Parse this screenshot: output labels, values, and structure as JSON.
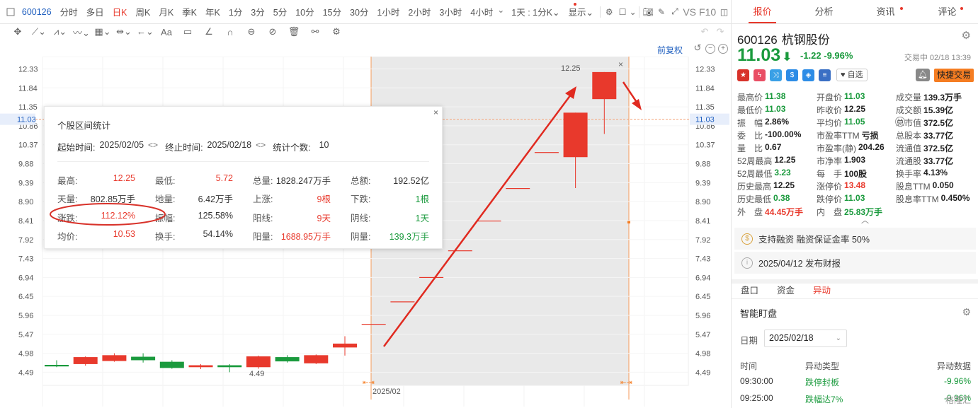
{
  "toolbar": {
    "code": "600126",
    "periods": [
      "分时",
      "多日",
      "日K",
      "周K",
      "月K",
      "季K",
      "年K",
      "1分",
      "3分",
      "5分",
      "10分",
      "15分",
      "30分",
      "1小时",
      "2小时",
      "3小时",
      "4小时"
    ],
    "active_period": "日K",
    "kline_select": "1天 : 1分K",
    "display_label": "显示",
    "vs_label": "VS",
    "f10_label": "F10"
  },
  "chart_header": {
    "restore_label": "前复权"
  },
  "chart_data": {
    "type": "candlestick",
    "y_ticks": [
      "12.33",
      "11.84",
      "11.35",
      "10.86",
      "10.37",
      "9.88",
      "9.39",
      "8.90",
      "8.41",
      "7.92",
      "7.43",
      "6.94",
      "6.45",
      "5.96",
      "5.47",
      "4.98",
      "4.49"
    ],
    "ylim": [
      4.15,
      12.65
    ],
    "current_price_label": "11.03",
    "current_price": 11.03,
    "x_label": "2025/02",
    "max_label": "12.25",
    "min_label": "4.49",
    "candles": [
      {
        "o": 4.68,
        "c": 4.64,
        "h": 4.8,
        "l": 4.62,
        "color": "green"
      },
      {
        "o": 4.7,
        "c": 4.88,
        "h": 4.9,
        "l": 4.66,
        "color": "red"
      },
      {
        "o": 4.78,
        "c": 4.93,
        "h": 4.98,
        "l": 4.76,
        "color": "red"
      },
      {
        "o": 4.89,
        "c": 4.8,
        "h": 4.98,
        "l": 4.74,
        "color": "green"
      },
      {
        "o": 4.76,
        "c": 4.6,
        "h": 4.8,
        "l": 4.58,
        "color": "green"
      },
      {
        "o": 4.67,
        "c": 4.62,
        "h": 4.7,
        "l": 4.57,
        "color": "red"
      },
      {
        "o": 4.67,
        "c": 4.62,
        "h": 4.7,
        "l": 4.49,
        "color": "green"
      },
      {
        "o": 4.62,
        "c": 4.9,
        "h": 4.92,
        "l": 4.58,
        "color": "red"
      },
      {
        "o": 4.88,
        "c": 4.77,
        "h": 4.93,
        "l": 4.74,
        "color": "green"
      },
      {
        "o": 4.72,
        "c": 4.93,
        "h": 4.95,
        "l": 4.7,
        "color": "red"
      },
      {
        "o": 5.13,
        "c": 5.23,
        "h": 5.42,
        "l": 4.92,
        "color": "red"
      },
      {
        "o": 5.74,
        "c": 5.74,
        "h": 5.74,
        "l": 5.74,
        "color": "red"
      },
      {
        "o": 6.32,
        "c": 6.32,
        "h": 6.32,
        "l": 6.32,
        "color": "red"
      },
      {
        "o": 6.95,
        "c": 6.95,
        "h": 6.95,
        "l": 6.95,
        "color": "red"
      },
      {
        "o": 7.64,
        "c": 7.64,
        "h": 7.64,
        "l": 7.64,
        "color": "red"
      },
      {
        "o": 8.41,
        "c": 8.41,
        "h": 8.41,
        "l": 8.41,
        "color": "red"
      },
      {
        "o": 9.25,
        "c": 9.25,
        "h": 9.25,
        "l": 9.25,
        "color": "red"
      },
      {
        "o": 10.18,
        "c": 10.18,
        "h": 10.18,
        "l": 10.18,
        "color": "red"
      },
      {
        "o": 10.05,
        "c": 11.2,
        "h": 11.2,
        "l": 9.25,
        "color": "red"
      },
      {
        "o": 11.55,
        "c": 12.25,
        "h": 12.25,
        "l": 10.65,
        "color": "red"
      }
    ]
  },
  "stats_popup": {
    "title": "个股区间统计",
    "start_label": "起始时间:",
    "start_date": "2025/02/05",
    "end_label": "终止时间:",
    "end_date": "2025/02/18",
    "count_label": "统计个数:",
    "count": "10",
    "rows": [
      [
        {
          "l": "最高:",
          "v": "12.25",
          "c": "red"
        },
        {
          "l": "最低:",
          "v": "5.72",
          "c": "red"
        },
        {
          "l": "总量:",
          "v": "1828.247万手",
          "c": ""
        },
        {
          "l": "总额:",
          "v": "192.52亿",
          "c": ""
        }
      ],
      [
        {
          "l": "天量:",
          "v": "802.85万手",
          "c": ""
        },
        {
          "l": "地量:",
          "v": "6.42万手",
          "c": ""
        },
        {
          "l": "上涨:",
          "v": "9根",
          "c": "red"
        },
        {
          "l": "下跌:",
          "v": "1根",
          "c": "green"
        }
      ],
      [
        {
          "l": "涨跌:",
          "v": "112.12%",
          "c": "red"
        },
        {
          "l": "振幅:",
          "v": "125.58%",
          "c": ""
        },
        {
          "l": "阳线:",
          "v": "9天",
          "c": "red"
        },
        {
          "l": "阴线:",
          "v": "1天",
          "c": "green"
        }
      ],
      [
        {
          "l": "均价:",
          "v": "10.53",
          "c": "red"
        },
        {
          "l": "换手:",
          "v": "54.14%",
          "c": ""
        },
        {
          "l": "阳量:",
          "v": "1688.95万手",
          "c": "red"
        },
        {
          "l": "阴量:",
          "v": "139.3万手",
          "c": "green"
        }
      ]
    ]
  },
  "right_panel": {
    "tabs": [
      "报价",
      "分析",
      "资讯",
      "评论"
    ],
    "stock_code": "600126",
    "stock_name": "杭钢股份",
    "price": "11.03",
    "change": "-1.22",
    "change_pct": "-9.96%",
    "status_time": "交易中 02/18 13:39",
    "zixuan_label": "自选",
    "quick_trade_label": "快捷交易",
    "quotes": [
      [
        {
          "l": "最高价",
          "v": "11.38",
          "c": "green"
        },
        {
          "l": "开盘价",
          "v": "11.03",
          "c": "green"
        },
        {
          "l": "成交量",
          "v": "139.3万手",
          "c": ""
        }
      ],
      [
        {
          "l": "最低价",
          "v": "11.03",
          "c": "green"
        },
        {
          "l": "昨收价",
          "v": "12.25",
          "c": ""
        },
        {
          "l": "成交额",
          "v": "15.39亿",
          "c": ""
        }
      ],
      [
        {
          "l": "振　幅",
          "v": "2.86%",
          "c": ""
        },
        {
          "l": "平均价",
          "v": "11.05",
          "c": "green"
        },
        {
          "l": "总市值",
          "v": "372.5亿",
          "c": ""
        }
      ],
      [
        {
          "l": "委　比",
          "v": "-100.00%",
          "c": ""
        },
        {
          "l": "市盈率TTM",
          "v": "亏损",
          "c": ""
        },
        {
          "l": "总股本",
          "v": "33.77亿",
          "c": ""
        }
      ],
      [
        {
          "l": "量　比",
          "v": "0.67",
          "c": ""
        },
        {
          "l": "市盈率(静)",
          "v": "204.26",
          "c": ""
        },
        {
          "l": "流通值",
          "v": "372.5亿",
          "c": ""
        }
      ],
      [
        {
          "l": "52周最高",
          "v": "12.25",
          "c": ""
        },
        {
          "l": "市净率",
          "v": "1.903",
          "c": ""
        },
        {
          "l": "流通股",
          "v": "33.77亿",
          "c": ""
        }
      ],
      [
        {
          "l": "52周最低",
          "v": "3.23",
          "c": "green"
        },
        {
          "l": "每　手",
          "v": "100股",
          "c": ""
        },
        {
          "l": "换手率",
          "v": "4.13%",
          "c": ""
        }
      ],
      [
        {
          "l": "历史最高",
          "v": "12.25",
          "c": ""
        },
        {
          "l": "涨停价",
          "v": "13.48",
          "c": "red"
        },
        {
          "l": "股息TTM",
          "v": "0.050",
          "c": ""
        }
      ],
      [
        {
          "l": "历史最低",
          "v": "0.38",
          "c": "green"
        },
        {
          "l": "跌停价",
          "v": "11.03",
          "c": "green"
        },
        {
          "l": "股息率TTM",
          "v": "0.450%",
          "c": ""
        }
      ],
      [
        {
          "l": "外　盘",
          "v": "44.45万手",
          "c": "red"
        },
        {
          "l": "内　盘",
          "v": "25.83万手",
          "c": "green"
        },
        {
          "l": "",
          "v": "",
          "c": ""
        }
      ]
    ],
    "margin_note": "支持融资 融资保证金率 50%",
    "report_note": "2025/04/12  发布财报",
    "bottom_tabs": [
      "盘口",
      "资金",
      "异动"
    ],
    "active_bottom_tab": "异动",
    "smart_title": "智能盯盘",
    "date_label": "日期",
    "date_value": "2025/02/18",
    "table_headers": [
      "时间",
      "异动类型",
      "异动数据"
    ],
    "table_rows": [
      {
        "time": "09:30:00",
        "type": "跌停封板",
        "data": "-9.96%"
      },
      {
        "time": "09:25:00",
        "type": "跌幅达7%",
        "data": "-9.96%"
      }
    ],
    "watermark": "格隆汇"
  },
  "colors": {
    "red": "#e8392c",
    "green": "#1a9a3d",
    "blue": "#1f5fbf",
    "orange": "#f57d22"
  }
}
